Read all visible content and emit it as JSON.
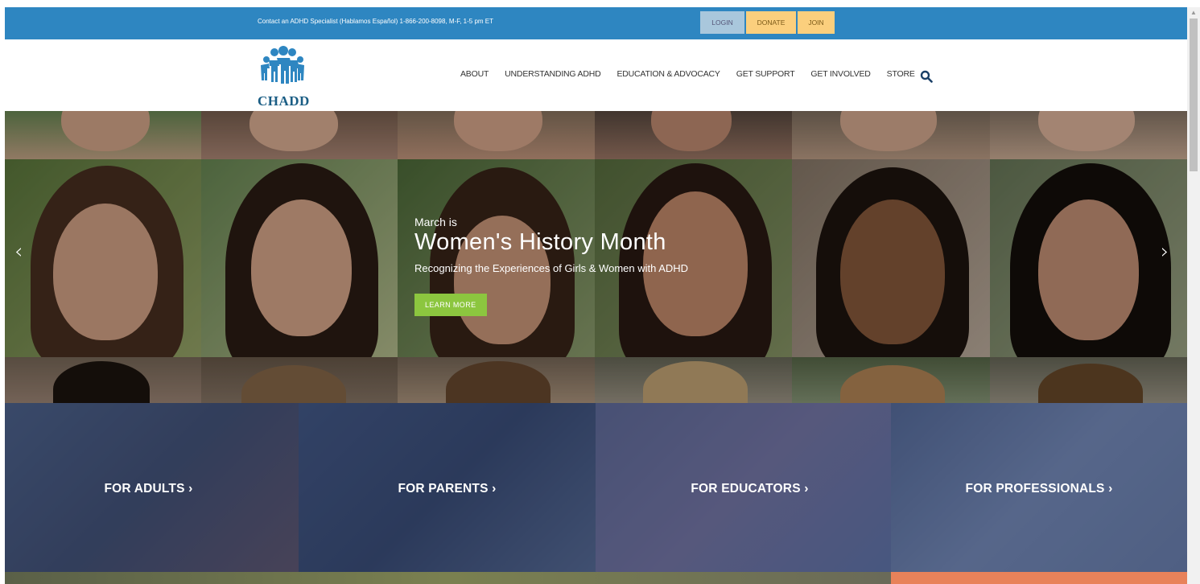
{
  "topbar": {
    "contact": "Contact an ADHD Specialist (Hablamos Español) 1-866-200-8098, M-F, 1-5 pm ET",
    "login": "LOGIN",
    "donate": "DONATE",
    "join": "JOIN",
    "color": "#2e86c1"
  },
  "header": {
    "logo_text": "CHADD",
    "nav": [
      "ABOUT",
      "UNDERSTANDING ADHD",
      "EDUCATION & ADVOCACY",
      "GET SUPPORT",
      "GET INVOLVED",
      "STORE"
    ],
    "search_icon": "search-icon"
  },
  "hero": {
    "pre_title": "March is",
    "title": "Women's History Month",
    "subtitle": "Recognizing the Experiences of Girls & Women with ADHD",
    "button": "LEARN MORE",
    "button_color": "#8cc63f",
    "prev_arrow": "‹",
    "next_arrow": "›"
  },
  "audiences": [
    "FOR ADULTS ›",
    "FOR PARENTS ›",
    "FOR EDUCATORS ›",
    "FOR PROFESSIONALS ›"
  ]
}
